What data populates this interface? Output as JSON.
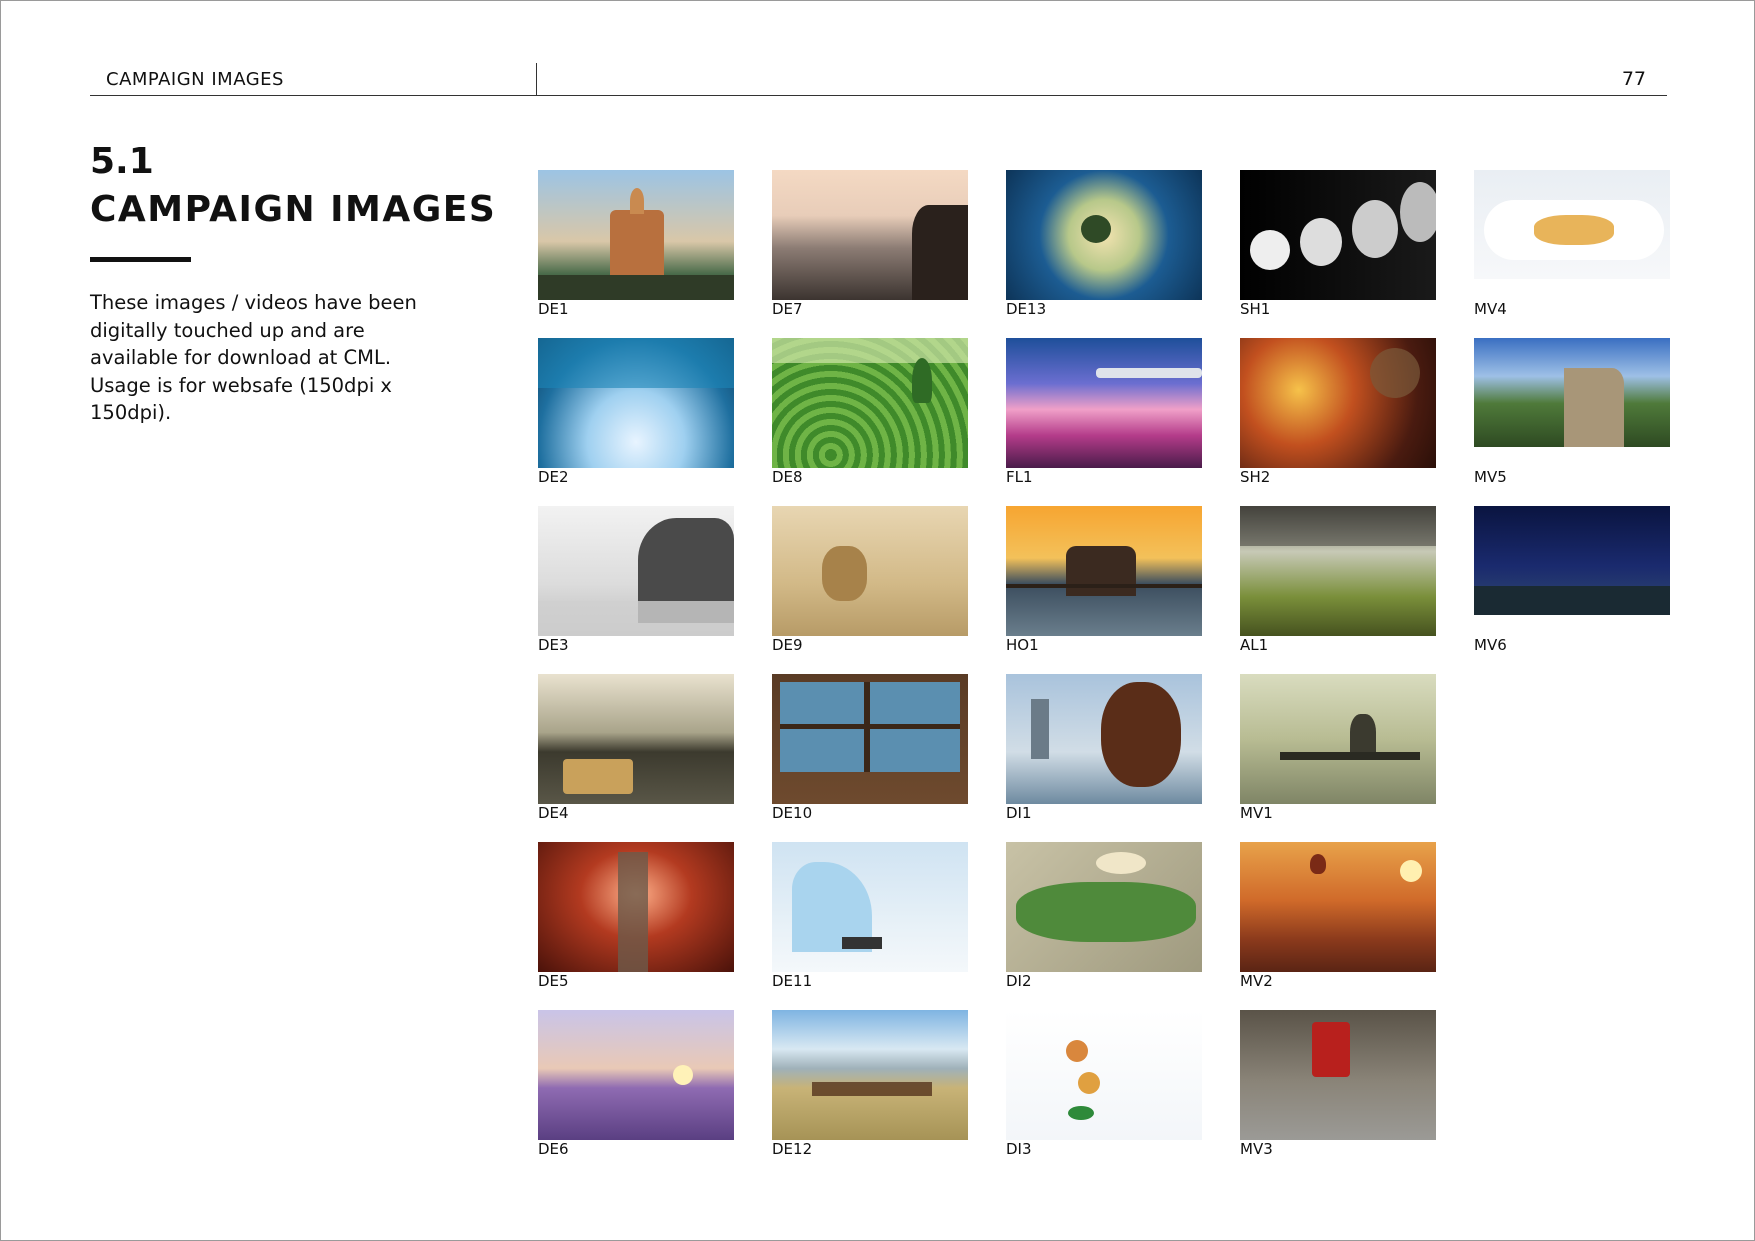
{
  "header": {
    "section_label": "CAMPAIGN IMAGES",
    "page_number": "77"
  },
  "section": {
    "number": "5.1",
    "title": "CAMPAIGN IMAGES",
    "intro": "These images / videos have been digitally touched up and are available for download at CML. Usage is for websafe (150dpi x 150dpi)."
  },
  "images": [
    {
      "code": "DE1",
      "scene": "temple-sunrise"
    },
    {
      "code": "DE2",
      "scene": "ice-cave"
    },
    {
      "code": "DE3",
      "scene": "karst-bay-mono"
    },
    {
      "code": "DE4",
      "scene": "bamboo-raft-river"
    },
    {
      "code": "DE5",
      "scene": "red-forest-boardwalk"
    },
    {
      "code": "DE6",
      "scene": "lavender-field-sunset"
    },
    {
      "code": "DE7",
      "scene": "mountain-cliff-mist"
    },
    {
      "code": "DE8",
      "scene": "tea-terraces"
    },
    {
      "code": "DE9",
      "scene": "cheetah-cub"
    },
    {
      "code": "DE10",
      "scene": "cabin-window"
    },
    {
      "code": "DE11",
      "scene": "penguins-iceberg"
    },
    {
      "code": "DE12",
      "scene": "horses-steppe"
    },
    {
      "code": "DE13",
      "scene": "tent-window-view"
    },
    {
      "code": "FL1",
      "scene": "airplane-wing-sky"
    },
    {
      "code": "HO1",
      "scene": "overwater-cabana"
    },
    {
      "code": "DI1",
      "scene": "bread-rings-istanbul"
    },
    {
      "code": "DI2",
      "scene": "floating-market-boat"
    },
    {
      "code": "DI3",
      "scene": "plated-dish"
    },
    {
      "code": "SH1",
      "scene": "row-of-bowls"
    },
    {
      "code": "SH2",
      "scene": "lanterns-bazaar"
    },
    {
      "code": "AL1",
      "scene": "airport-lounge"
    },
    {
      "code": "MV1",
      "scene": "fisherman-river"
    },
    {
      "code": "MV2",
      "scene": "balloon-temples"
    },
    {
      "code": "MV3",
      "scene": "red-tram-street"
    },
    {
      "code": "MV4",
      "scene": "crepes-plate",
      "short": true
    },
    {
      "code": "MV5",
      "scene": "great-wall",
      "short": true
    },
    {
      "code": "MV6",
      "scene": "night-sky-mountains",
      "short": true
    }
  ]
}
